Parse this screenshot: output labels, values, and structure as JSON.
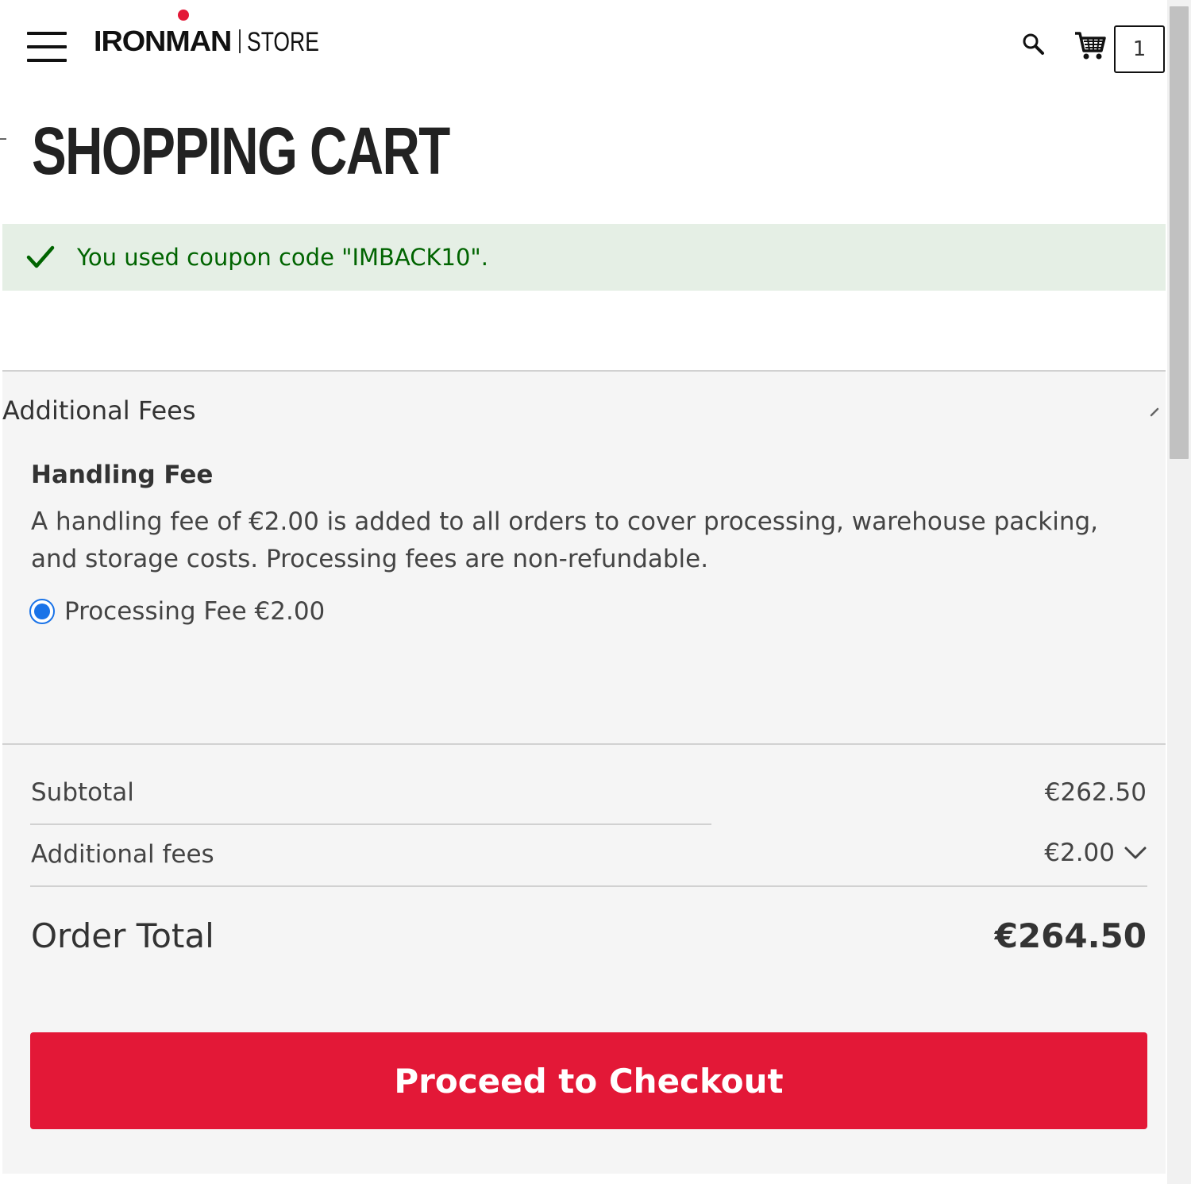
{
  "header": {
    "logo_brand": "IRONMAN",
    "logo_store": "STORE",
    "cart_count": "1"
  },
  "page_title": "SHOPPING CART",
  "message": {
    "text": "You used coupon code \"IMBACK10\"."
  },
  "fees": {
    "title": "Additional Fees",
    "heading": "Handling Fee",
    "description": "A handling fee of €2.00 is added to all orders to cover processing, warehouse packing, and storage costs. Processing fees are non-refundable.",
    "option_label": "Processing Fee €2.00",
    "option_selected": true
  },
  "summary": {
    "subtotal_label": "Subtotal",
    "subtotal_value": "€262.50",
    "fees_label": "Additional fees",
    "fees_value": "€2.00",
    "total_label": "Order Total",
    "total_value": "€264.50"
  },
  "checkout_label": "Proceed to Checkout",
  "colors": {
    "brand_red": "#e31837",
    "success_bg": "#e5efe5",
    "success_text": "#006400",
    "radio_blue": "#1a73e8"
  },
  "icons": [
    "menu-icon",
    "search-icon",
    "cart-icon",
    "check-icon",
    "chevron-up-icon",
    "chevron-down-icon"
  ]
}
